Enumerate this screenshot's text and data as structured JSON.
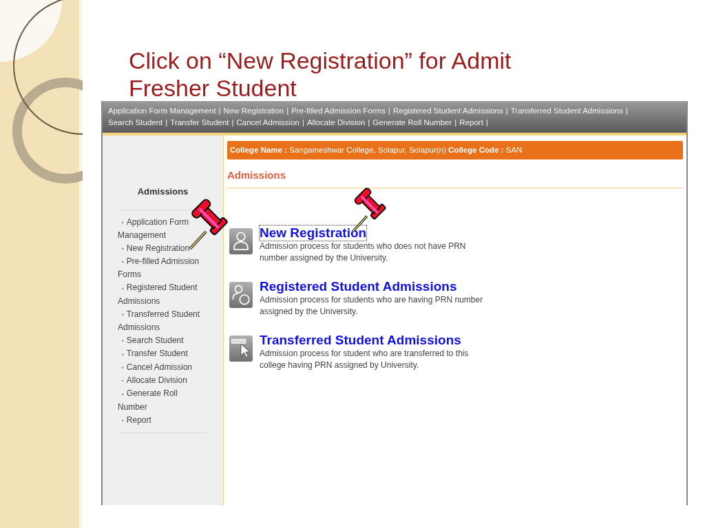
{
  "slide": {
    "title": "Click on “New Registration” for Admit Fresher Student"
  },
  "nav": {
    "separator": "|",
    "links": [
      "Application Form Management",
      "New Registration",
      "Pre-filled Admission Forms",
      "Registered Student Admissions",
      "Transferred Student Admissions",
      "Search Student",
      "Transfer Student",
      "Cancel Admission",
      "Allocate Division",
      "Generate Roll Number",
      "Report"
    ]
  },
  "sidebar": {
    "heading": "Admissions",
    "bullet": "▪",
    "items": [
      "Application Form Management",
      "New Registration",
      "Pre-filled Admission Forms",
      "Registered Student Admissions",
      "Transferred Student Admissions",
      "Search Student",
      "Transfer Student",
      "Cancel Admission",
      "Allocate Division",
      "Generate Roll Number",
      "Report"
    ]
  },
  "college_bar": "**College Name :** Sangameshwar College, Solapur, Solapur(n) **College Code :** SAN",
  "section_heading": "Admissions",
  "options": [
    {
      "kind": "person",
      "title": "New Registration",
      "description": "Admission process for students who does not have PRN number assigned by the University.",
      "focused": true
    },
    {
      "kind": "prn",
      "title": "Registered Student Admissions",
      "description": "Admission process for students who are having PRN number assigned by the University.",
      "focused": false
    },
    {
      "kind": "cursor",
      "title": "Transferred Student Admissions",
      "description": "Admission process for student who are transferred to this college having PRN assigned by University.",
      "focused": false
    }
  ]
}
